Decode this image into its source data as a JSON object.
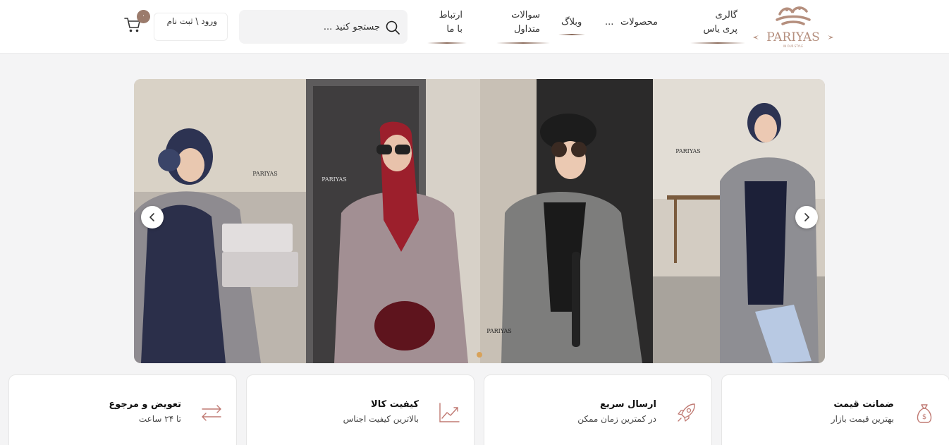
{
  "header": {
    "logo_text": "PARIYAS",
    "logo_tagline": "IN OUR STYLE",
    "nav": [
      {
        "label": "گالری پری یاس"
      },
      {
        "label": "محصولات"
      },
      {
        "label": "..."
      },
      {
        "label": "وبلاگ"
      },
      {
        "label": "سوالات متداول"
      },
      {
        "label": "ارتباط با ما"
      }
    ],
    "search_placeholder": "جستجو کنید ...",
    "login_label": "ورود \\ ثبت نام",
    "cart_count": "۰"
  },
  "slider": {
    "brand_stamp": "PARIYAS",
    "prev_icon": "chevron-left-icon",
    "next_icon": "chevron-right-icon",
    "active_dot_color": "#d8a25a"
  },
  "features": [
    {
      "title": "ضمانت قیمت",
      "subtitle": "بهترین قیمت بازار",
      "icon": "money-bag-icon"
    },
    {
      "title": "ارسال سریع",
      "subtitle": "در کمترین زمان ممکن",
      "icon": "rocket-icon"
    },
    {
      "title": "کیفیت کالا",
      "subtitle": "بالاترین کیفیت اجناس",
      "icon": "trend-chart-icon"
    },
    {
      "title": "تعویض و مرجوع",
      "subtitle": "تا ۲۴ ساعت",
      "icon": "exchange-arrows-icon"
    }
  ],
  "colors": {
    "accent": "#9b7b6c",
    "page_bg": "#f4f4f5"
  }
}
